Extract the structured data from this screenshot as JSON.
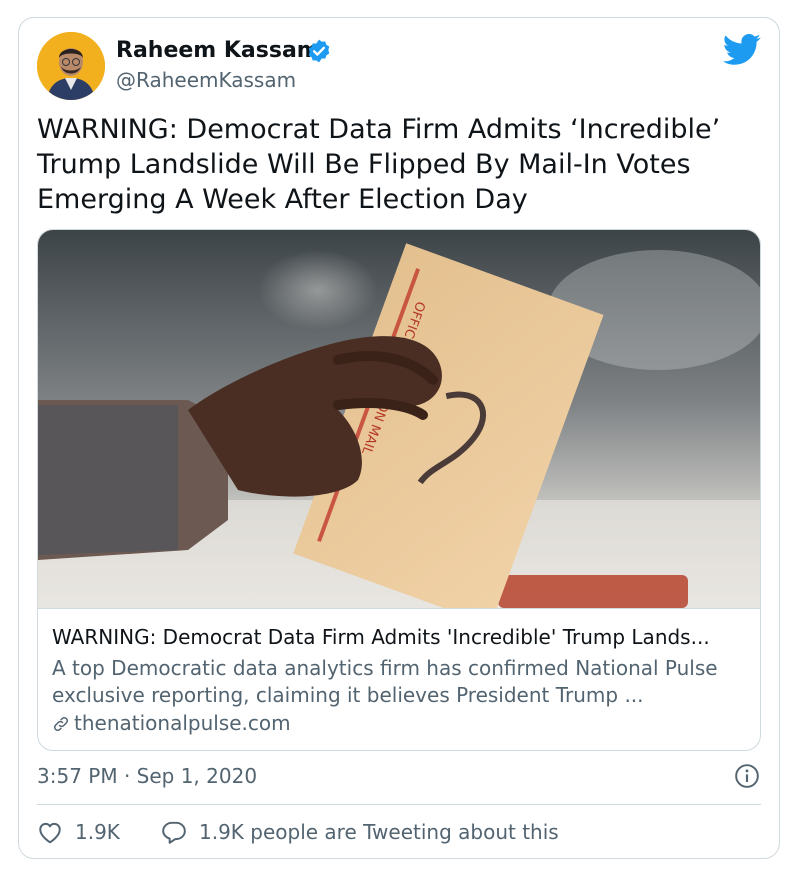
{
  "author": {
    "name": "Raheem Kassam",
    "handle": "@RaheemKassam",
    "verified": true,
    "avatar_icon": "profile-photo"
  },
  "platform_icon": "twitter-bird-icon",
  "tweet": {
    "text": "WARNING: Democrat Data Firm Admits ‘Incredible’\nTrump Landslide Will Be Flipped By Mail-In Votes\nEmerging A Week After Election Day"
  },
  "link_card": {
    "image_icon": "ballot-envelope-photo",
    "image_text": "OFFICIAL ELECTION MAIL",
    "title": "WARNING: Democrat Data Firm Admits 'Incredible' Trump Lands...",
    "description": "A top Democratic data analytics firm has confirmed National Pulse exclusive reporting, claiming it believes President Trump ...",
    "domain": "thenationalpulse.com"
  },
  "timestamp": "3:57 PM · Sep 1, 2020",
  "stats": {
    "likes": "1.9K",
    "replies_text": "1.9K people are Tweeting about this"
  },
  "colors": {
    "text": "#0f1419",
    "secondary": "#536471",
    "border": "#cfd9de",
    "twitter_blue": "#1d9bf0"
  }
}
